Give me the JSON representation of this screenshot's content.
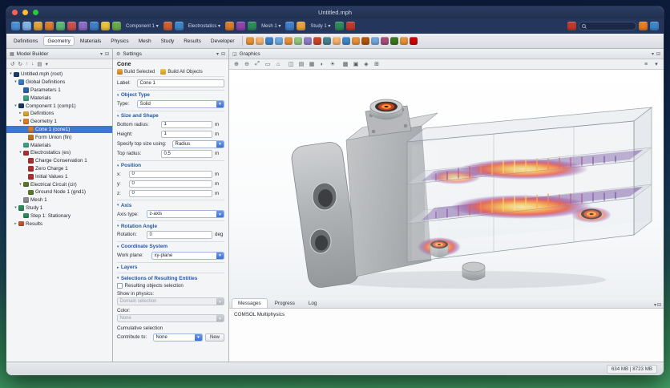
{
  "window": {
    "title": "Untitled.mph"
  },
  "quickbar": {
    "icons_a": [
      "#4a8fd4",
      "#7fb2e6",
      "#e0a23c",
      "#d97b2a",
      "#5bb573",
      "#c94f4f",
      "#8d6ac4",
      "#3f7fc9",
      "#e8c23d",
      "#6aa84f"
    ],
    "component_label": "Component 1 ▾",
    "icons_b": [
      "#cc5f33",
      "#3d85c6"
    ],
    "physics_label": "Electrostatics ▾",
    "icons_c": [
      "#d97b2a",
      "#8e44ad",
      "#2e8a5a"
    ],
    "mesh_label": "Mesh 1 ▾",
    "icons_d": [
      "#3f7fc9",
      "#e8a33d"
    ],
    "study_label": "Study 1 ▾",
    "icons_e": [
      "#2e8a5a",
      "#c0392b"
    ],
    "icons_right": [
      "#c0392b",
      "#e67e22",
      "#3d85c6"
    ]
  },
  "ribbon": {
    "tabs": [
      {
        "label": "Definitions",
        "active": false
      },
      {
        "label": "Geometry",
        "active": true
      },
      {
        "label": "Materials",
        "active": false
      },
      {
        "label": "Physics",
        "active": false
      },
      {
        "label": "Mesh",
        "active": false
      },
      {
        "label": "Study",
        "active": false
      },
      {
        "label": "Results",
        "active": false
      },
      {
        "label": "Developer",
        "active": false
      }
    ],
    "icons": [
      "#e69138",
      "#f6b26b",
      "#3d85c6",
      "#6fa8dc",
      "#e69138",
      "#93c47d",
      "#8e7cc3",
      "#cc4125",
      "#45818e",
      "#f6b26b",
      "#3d85c6",
      "#e69138",
      "#b45309",
      "#6fa8dc",
      "#a64d79",
      "#38761d",
      "#e69138",
      "#cc0000"
    ]
  },
  "model_builder": {
    "tab_title": "Model Builder",
    "header_icons": [
      "▾",
      "⊟"
    ],
    "toolbar_icons": [
      "↺",
      "↻",
      "↑",
      "↓",
      "▤",
      "▾"
    ],
    "tree": [
      {
        "expander": "▾",
        "icon_color": "#1a3e6e",
        "label": "Untitled.mph (root)",
        "selected": false
      },
      {
        "expander": "▾",
        "icon_color": "#3a79c9",
        "label": "Global Definitions",
        "selected": false
      },
      {
        "expander": "",
        "icon_color": "#2e62b0",
        "label": "Parameters 1",
        "selected": false
      },
      {
        "expander": "",
        "icon_color": "#3fa38a",
        "label": "Materials",
        "selected": false
      },
      {
        "expander": "▾",
        "icon_color": "#173a63",
        "label": "Component 1 (comp1)",
        "selected": false
      },
      {
        "expander": "▸",
        "icon_color": "#e0a52e",
        "label": "Definitions",
        "selected": false
      },
      {
        "expander": "▾",
        "icon_color": "#d97f2a",
        "label": "Geometry 1",
        "selected": false
      },
      {
        "expander": "",
        "icon_color": "#d97f2a",
        "label": "Cone 1 (cone1)",
        "selected": true
      },
      {
        "expander": "",
        "icon_color": "#b9762a",
        "label": "Form Union (fin)",
        "selected": false
      },
      {
        "expander": "",
        "icon_color": "#3fa38a",
        "label": "Materials",
        "selected": false
      },
      {
        "expander": "▾",
        "icon_color": "#b03030",
        "label": "Electrostatics (es)",
        "selected": false
      },
      {
        "expander": "",
        "icon_color": "#b03030",
        "label": "Charge Conservation 1",
        "selected": false
      },
      {
        "expander": "",
        "icon_color": "#b03030",
        "label": "Zero Charge 1",
        "selected": false
      },
      {
        "expander": "",
        "icon_color": "#b03030",
        "label": "Initial Values 1",
        "selected": false
      },
      {
        "expander": "▾",
        "icon_color": "#5a7a2e",
        "label": "Electrical Circuit (cir)",
        "selected": false
      },
      {
        "expander": "",
        "icon_color": "#5a7a2e",
        "label": "Ground Node 1 (gnd1)",
        "selected": false
      },
      {
        "expander": "",
        "icon_color": "#8a8f96",
        "label": "Mesh 1",
        "selected": false
      },
      {
        "expander": "▾",
        "icon_color": "#2e8a5a",
        "label": "Study 1",
        "selected": false
      },
      {
        "expander": "",
        "icon_color": "#2e8a5a",
        "label": "Step 1: Stationary",
        "selected": false
      },
      {
        "expander": "▸",
        "icon_color": "#c05a2e",
        "label": "Results",
        "selected": false
      }
    ]
  },
  "settings": {
    "tab_title": "Settings",
    "heading": "Cone",
    "toolbar": {
      "build_selected": "Build Selected",
      "build_all": "Build All Objects"
    },
    "label_row": {
      "label": "Label:",
      "value": "Cone 1"
    },
    "object_type": {
      "title": "Object Type",
      "type_label": "Type:",
      "type_value": "Solid"
    },
    "size_shape": {
      "title": "Size and Shape",
      "rows": [
        {
          "label": "Bottom radius:",
          "value": "1",
          "unit": "m"
        },
        {
          "label": "Height:",
          "value": "1",
          "unit": "m"
        }
      ],
      "specify_label": "Specify top size using:",
      "specify_value": "Radius",
      "top_radius_label": "Top radius:",
      "top_radius_value": "0.5",
      "top_radius_unit": "m"
    },
    "position": {
      "title": "Position",
      "rows": [
        {
          "label": "x:",
          "value": "0",
          "unit": "m"
        },
        {
          "label": "y:",
          "value": "0",
          "unit": "m"
        },
        {
          "label": "z:",
          "value": "0",
          "unit": "m"
        }
      ]
    },
    "axis": {
      "title": "Axis",
      "axis_type_label": "Axis type:",
      "axis_type_value": "z-axis"
    },
    "rotation": {
      "title": "Rotation Angle",
      "rotation_label": "Rotation:",
      "rotation_value": "0",
      "rotation_unit": "deg"
    },
    "coordinate_system": {
      "title": "Coordinate System",
      "work_plane_label": "Work plane:",
      "work_plane_value": "xy-plane"
    },
    "layers": {
      "title": "Layers"
    },
    "selections": {
      "title": "Selections of Resulting Entities",
      "resulting_label": "Resulting objects selection",
      "show_label": "Show in physics:",
      "show_value": "Domain selection",
      "color_label": "Color:",
      "color_value": "None",
      "cumulative_label": "Cumulative selection",
      "contribute_label": "Contribute to:",
      "contribute_value": "None",
      "new_button": "New"
    }
  },
  "graphics": {
    "tab_title": "Graphics",
    "header_icons": [
      "▾",
      "⊟"
    ],
    "toolbar": [
      {
        "glyph": "⊕"
      },
      {
        "glyph": "⊖"
      },
      {
        "glyph": "⤢"
      },
      {
        "glyph": "▭"
      },
      {
        "glyph": "⌂"
      },
      {
        "glyph": "◫"
      },
      {
        "glyph": "▤"
      },
      {
        "glyph": "▦"
      },
      {
        "glyph": "◐"
      },
      {
        "glyph": "☀"
      },
      {
        "glyph": "▩"
      },
      {
        "glyph": "▣"
      },
      {
        "glyph": "◈"
      },
      {
        "glyph": "⊞"
      },
      {
        "glyph": "≡"
      },
      {
        "glyph": "▾"
      }
    ]
  },
  "messages": {
    "tabs": [
      {
        "label": "Messages",
        "active": true
      },
      {
        "label": "Progress",
        "active": false
      },
      {
        "label": "Log",
        "active": false
      }
    ],
    "content": "COMSOL Multiphysics"
  },
  "status_bar": {
    "memory": "634 MB | 8723 MB"
  }
}
